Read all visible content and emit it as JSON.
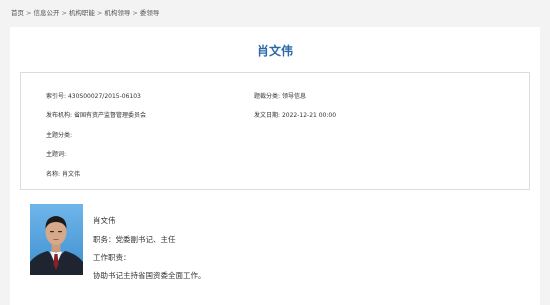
{
  "breadcrumb": {
    "items": [
      "首页",
      "信息公开",
      "机构职能",
      "机构领导",
      "委领导"
    ],
    "separator": ">"
  },
  "article": {
    "title": "肖文伟",
    "accent_color": "#2b6aa6"
  },
  "meta": {
    "index_label": "索引号:",
    "index_value": "430S00027/2015-06103",
    "category_label": "题裁分类:",
    "category_value": "领导信息",
    "publisher_label": "发布机构:",
    "publisher_value": "省国有资产监督管理委员会",
    "date_label": "发文日期:",
    "date_value": "2022-12-21 00:00",
    "topic_label": "主题分类:",
    "topic_value": "",
    "keyword_label": "主题词:",
    "keyword_value": "",
    "name_label": "名称:",
    "name_value": "肖文伟"
  },
  "profile": {
    "name": "肖文伟",
    "position": "职务：党委副书记、主任",
    "duties_label": "工作职责：",
    "duties": "协助书记主持省国资委全面工作。",
    "photo_icon": "portrait-photo"
  }
}
